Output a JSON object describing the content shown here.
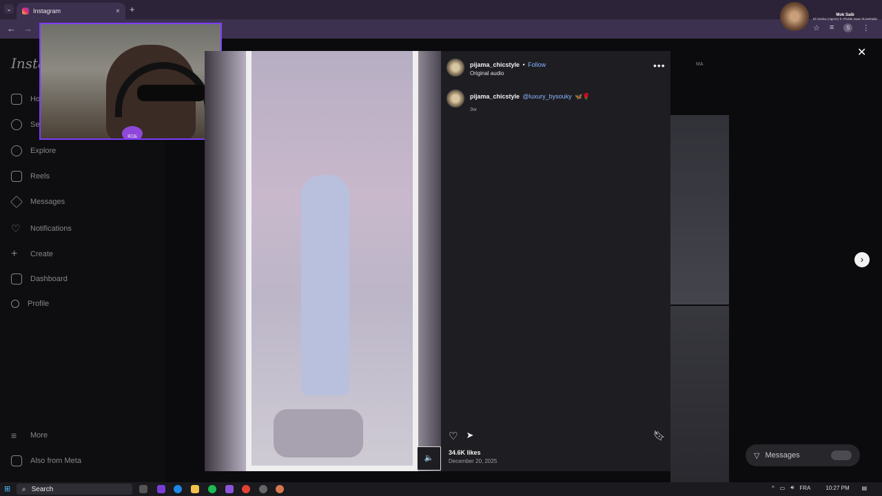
{
  "browser": {
    "tab_title": "Instagram",
    "tab_close": "×",
    "new_tab": "+",
    "tab_menu": "⌄",
    "back": "←",
    "forward": "→",
    "profile_initial": "S",
    "more_menu": "⋮",
    "now_playing": {
      "title": "Mok Saib",
      "subtitle": "El Gtorba (Algerie) ft. Phobik Isaac #LiveRadio"
    }
  },
  "sidebar": {
    "logo": "Instag",
    "items": [
      {
        "label": "Ho",
        "icon": "home-icon"
      },
      {
        "label": "Se",
        "icon": "search-icon"
      },
      {
        "label": "Explore",
        "icon": "explore-icon"
      },
      {
        "label": "Reels",
        "icon": "reels-icon"
      },
      {
        "label": "Messages",
        "icon": "messages-icon"
      },
      {
        "label": "Notifications",
        "icon": "heart-icon"
      },
      {
        "label": "Create",
        "icon": "plus-icon"
      },
      {
        "label": "Dashboard",
        "icon": "dashboard-icon"
      },
      {
        "label": "Profile",
        "icon": "profile-icon"
      }
    ],
    "more": "More",
    "also_from_meta": "Also from Meta"
  },
  "webcam": {
    "badge": "ЯΞIБ"
  },
  "post": {
    "username": "pijama_chicstyle",
    "separator": "•",
    "follow": "Follow",
    "audio": "Original audio",
    "options": "•••",
    "caption_user": "pijama_chicstyle",
    "caption_mention": "@luxury_bysouky",
    "caption_emoji": "🦋🌹",
    "caption_time": "3w",
    "likes": "34.6K likes",
    "date": "December 20, 2025",
    "mute_icon": "🔈"
  },
  "overlay": {
    "close": "✕",
    "next": "›",
    "background_label": "MA",
    "messages_button": "Messages"
  },
  "taskbar": {
    "search": "Search",
    "language": "FRA",
    "time": "10:27 PM"
  },
  "colors": {
    "accent_link": "#8ab4ff",
    "webcam_border": "#7d3cff",
    "browser_chrome": "#2c2338"
  }
}
